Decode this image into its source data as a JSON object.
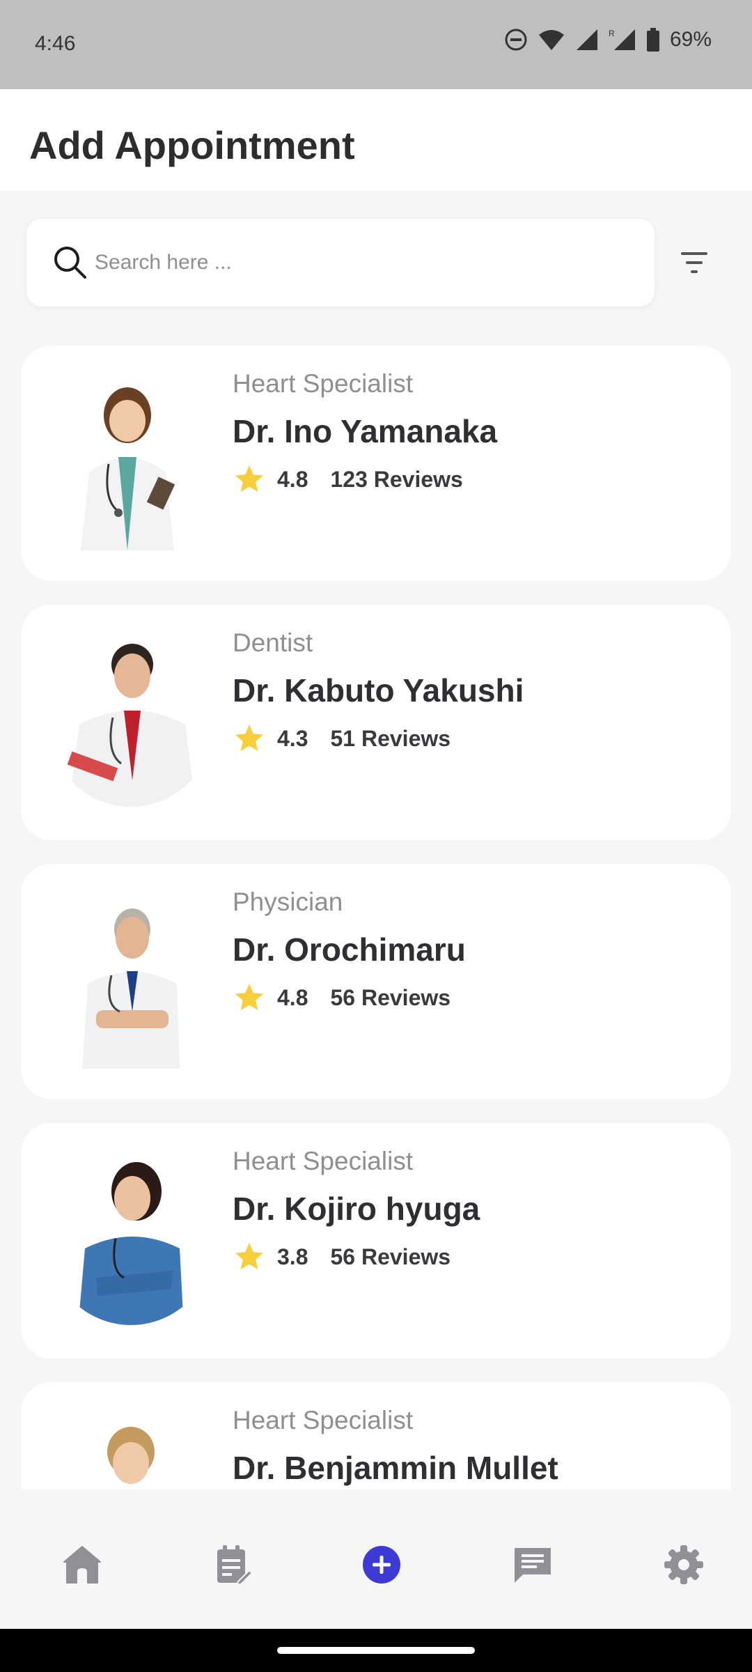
{
  "status_bar": {
    "time": "4:46",
    "battery": "69%"
  },
  "header": {
    "title": "Add Appointment"
  },
  "search": {
    "placeholder": "Search here ..."
  },
  "doctors": [
    {
      "specialty": "Heart Specialist",
      "name": "Dr. Ino Yamanaka",
      "rating": "4.8",
      "reviews": "123 Reviews"
    },
    {
      "specialty": "Dentist",
      "name": "Dr. Kabuto Yakushi",
      "rating": "4.3",
      "reviews": "51 Reviews"
    },
    {
      "specialty": "Physician",
      "name": "Dr. Orochimaru",
      "rating": "4.8",
      "reviews": "56 Reviews"
    },
    {
      "specialty": "Heart Specialist",
      "name": "Dr. Kojiro hyuga",
      "rating": "3.8",
      "reviews": "56 Reviews"
    },
    {
      "specialty": "Heart Specialist",
      "name": "Dr. Benjammin Mullet"
    }
  ],
  "bottom_nav": {
    "items": [
      {
        "icon": "home-icon",
        "active": false
      },
      {
        "icon": "notes-icon",
        "active": false
      },
      {
        "icon": "add-icon",
        "active": true
      },
      {
        "icon": "chat-icon",
        "active": false
      },
      {
        "icon": "settings-icon",
        "active": false
      }
    ]
  },
  "colors": {
    "accent": "#3d3ad6",
    "star": "#f7cf3a",
    "nav_inactive": "#909096"
  }
}
